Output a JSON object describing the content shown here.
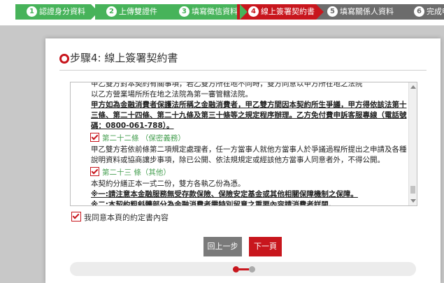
{
  "steps": [
    {
      "num": "1",
      "label": "認證身分資料",
      "state": "done"
    },
    {
      "num": "2",
      "label": "上傳雙證件",
      "state": "done"
    },
    {
      "num": "3",
      "label": "填寫徵信資料",
      "state": "done"
    },
    {
      "num": "4",
      "label": "線上簽署契約書",
      "state": "active"
    },
    {
      "num": "5",
      "label": "填寫關係人資料",
      "state": "todo"
    },
    {
      "num": "6",
      "label": "完成申",
      "state": "todo"
    }
  ],
  "page": {
    "title": "步驟4: 線上簽署契約書"
  },
  "contract": {
    "cutoff_line": "甲乙雙方對本契約有關事項，若乙雙方所在地不同時，雙方同意以甲方所在地之法院",
    "para1_tail": "以乙方營業場所所在地之法院為第一審管轄法院。",
    "para2_bold": "甲方如為金融消費者保護法所稱之金融消費者，甲乙雙方間因本契約所生爭議，甲方得依該法第十三條、第二十四條、第二十九條及第三十條等之規定程序辦理。乙方免付費申訴客服專線（電話號碼：0800-061-788）。",
    "article22_title": "第二十二條 （保密義務）",
    "article22_text": "甲乙雙方若依前條第二項規定處理者，任一方當事人就他方當事人於爭議過程所提出之申請及各種說明資料或協商讓步事項，除已公開、依法規規定或經該他方當事人同意者外，不得公開。",
    "article23_title": "第二十三 條（其他）",
    "article23_text": "本契約分繕正本一式二份，雙方各執乙份為憑。",
    "note1": "※一:請注意本金融服務無受存款保險、保險安定基金或其他相關保障機制之保障。",
    "note2": "※二:本契約粗斜體部分為金融消費者需特別留意之重要內容請消費者詳閱。"
  },
  "agree": {
    "label": "我同意本頁的約定書內容",
    "checked": true
  },
  "buttons": {
    "prev": "回上一步",
    "next": "下一頁"
  },
  "pager": {
    "current": 1,
    "total": 2
  },
  "colors": {
    "accent": "#c8161d",
    "done": "#47b35a",
    "todo": "#6c6c6c"
  }
}
